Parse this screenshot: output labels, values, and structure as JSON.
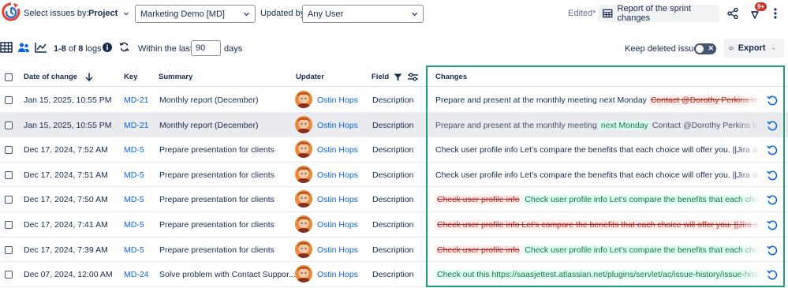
{
  "header": {
    "select_issues_label": "Select issues by:",
    "project_dropdown": "Project",
    "project_value": "Marketing Demo [MD]",
    "updated_by_label": "Updated by:",
    "updated_by_value": "Any User",
    "edited_label": "Edited*",
    "report_button": "Report of the sprint changes",
    "notification_badge": "9+"
  },
  "toolbar": {
    "logs_range": "1-8",
    "logs_of": "of",
    "logs_total": "8",
    "logs_word": "logs",
    "within_label": "Within the last:",
    "days_value": "90",
    "days_label": "days",
    "keep_deleted_label": "Keep deleted issues",
    "keep_deleted_on": false,
    "export_button": "Export"
  },
  "table": {
    "columns": {
      "date": "Date of change",
      "key": "Key",
      "summary": "Summary",
      "updater": "Updater",
      "field": "Field",
      "changes": "Changes"
    },
    "rows": [
      {
        "date": "Jan 15, 2025, 10:55 PM",
        "key": "MD-21",
        "summary": "Monthly report (December)",
        "updater": "Ostin Hops",
        "field": "Description",
        "selected": false,
        "segments": [
          {
            "type": "plain",
            "text": "Prepare and present at the monthly meeting next Monday "
          },
          {
            "type": "del",
            "text": "Contact @Dorothy Perkins to get all data for the report"
          }
        ]
      },
      {
        "date": "Jan 15, 2025, 10:55 PM",
        "key": "MD-21",
        "summary": "Monthly report (December)",
        "updater": "Ostin Hops",
        "field": "Description",
        "selected": true,
        "segments": [
          {
            "type": "grey",
            "text": "Prepare and present at the monthly meeting "
          },
          {
            "type": "add",
            "text": "next Monday"
          },
          {
            "type": "grey",
            "text": " Contact @Dorothy Perkins to get all data for the report"
          }
        ]
      },
      {
        "date": "Dec 17, 2024, 7:52 AM",
        "key": "MD-5",
        "summary": "Prepare presentation for clients",
        "updater": "Ostin Hops",
        "field": "Description",
        "selected": false,
        "segments": [
          {
            "type": "plain",
            "text": "Check user profile info Let’s compare the benefits that each choice will offer you. ||Jira activity report"
          }
        ]
      },
      {
        "date": "Dec 17, 2024, 7:51 AM",
        "key": "MD-5",
        "summary": "Prepare presentation for clients",
        "updater": "Ostin Hops",
        "field": "Description",
        "selected": false,
        "segments": [
          {
            "type": "plain",
            "text": "Check user profile info Let’s compare the benefits that each choice will offer you. ||Jira activity report"
          }
        ]
      },
      {
        "date": "Dec 17, 2024, 7:50 AM",
        "key": "MD-5",
        "summary": "Prepare presentation for clients",
        "updater": "Ostin Hops",
        "field": "Description",
        "selected": false,
        "segments": [
          {
            "type": "del",
            "text": "Check user profile info"
          },
          {
            "type": "plain",
            "text": " "
          },
          {
            "type": "add",
            "text": "Check user profile info Let’s compare the benefits that each choice will offer you."
          }
        ]
      },
      {
        "date": "Dec 17, 2024, 7:41 AM",
        "key": "MD-5",
        "summary": "Prepare presentation for clients",
        "updater": "Ostin Hops",
        "field": "Description",
        "selected": false,
        "segments": [
          {
            "type": "del",
            "text": "Check user profile info Let’s compare the benefits that each choice will offer you. ||Jira activity report"
          }
        ]
      },
      {
        "date": "Dec 17, 2024, 7:39 AM",
        "key": "MD-5",
        "summary": "Prepare presentation for clients",
        "updater": "Ostin Hops",
        "field": "Description",
        "selected": false,
        "segments": [
          {
            "type": "del",
            "text": "Check user profile info"
          },
          {
            "type": "plain",
            "text": " "
          },
          {
            "type": "add",
            "text": "Check user profile info Let’s compare the benefits that each choice will offer you."
          }
        ]
      },
      {
        "date": "Dec 07, 2024, 12:00 AM",
        "key": "MD-24",
        "summary": "Solve problem with Contact Suppor...",
        "updater": "Ostin Hops",
        "field": "Description",
        "selected": false,
        "segments": [
          {
            "type": "add",
            "text": "Check out this https://saasjettest.atlassian.net/plugins/servlet/ac/issue-history/issue-history?project.key=MD"
          }
        ]
      }
    ]
  },
  "colors": {
    "accent_frame": "#1f9d74",
    "link": "#0c66e4",
    "deleted_bg": "#ffeceb",
    "added_bg": "#dcfff1"
  },
  "icons": [
    "app-logo-icon",
    "chevron-down-icon",
    "table-view-icon",
    "people-icon",
    "chart-icon",
    "info-icon",
    "refresh-icon",
    "toggle-x-icon",
    "cloud-export-icon",
    "report-table-icon",
    "share-icon",
    "notification-icon",
    "more-icon",
    "sort-arrow-icon",
    "filter-icon",
    "settings-sliders-icon",
    "revert-icon"
  ]
}
